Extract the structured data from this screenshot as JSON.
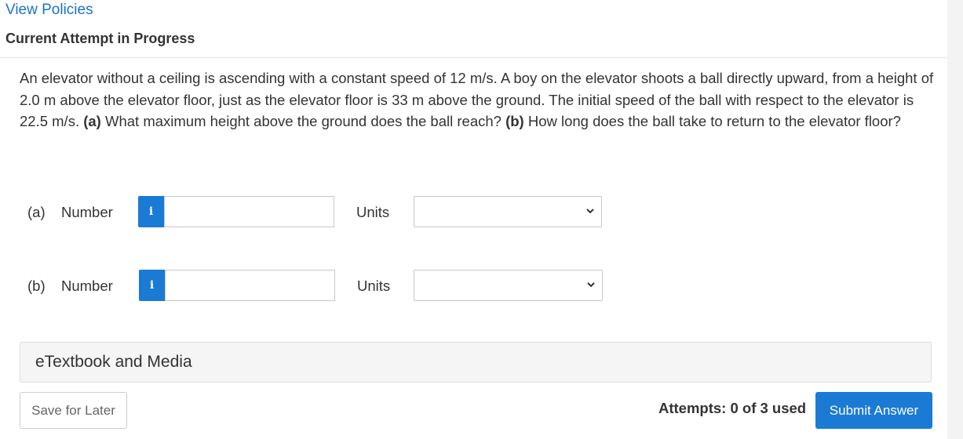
{
  "header": {
    "policies_link": "View Policies",
    "attempt_title": "Current Attempt in Progress"
  },
  "question": {
    "text_intro": "An elevator without a ceiling is ascending with a constant speed of 12 m/s. A boy on the elevator shoots a ball directly upward, from a height of 2.0 m above the elevator floor, just as the elevator floor is 33 m above the ground. The initial speed of the ball with respect to the elevator is 22.5 m/s. ",
    "part_a_label": "(a)",
    "part_a_text": " What maximum height above the ground does the ball reach? ",
    "part_b_label": "(b)",
    "part_b_text": " How long does the ball take to return to the elevator floor?"
  },
  "answers": {
    "a": {
      "part": "(a)",
      "number_label": "Number",
      "info_icon": "i",
      "value": "",
      "units_label": "Units",
      "units_value": ""
    },
    "b": {
      "part": "(b)",
      "number_label": "Number",
      "info_icon": "i",
      "value": "",
      "units_label": "Units",
      "units_value": ""
    }
  },
  "resources": {
    "etextbook_label": "eTextbook and Media"
  },
  "footer": {
    "save_label": "Save for Later",
    "attempts_text": "Attempts: 0 of 3 used",
    "submit_label": "Submit Answer"
  },
  "colors": {
    "accent": "#1a7ad4",
    "link": "#1a73c8"
  },
  "icons": {
    "info": "info-icon",
    "select_chevron": "chevron-down-icon"
  }
}
